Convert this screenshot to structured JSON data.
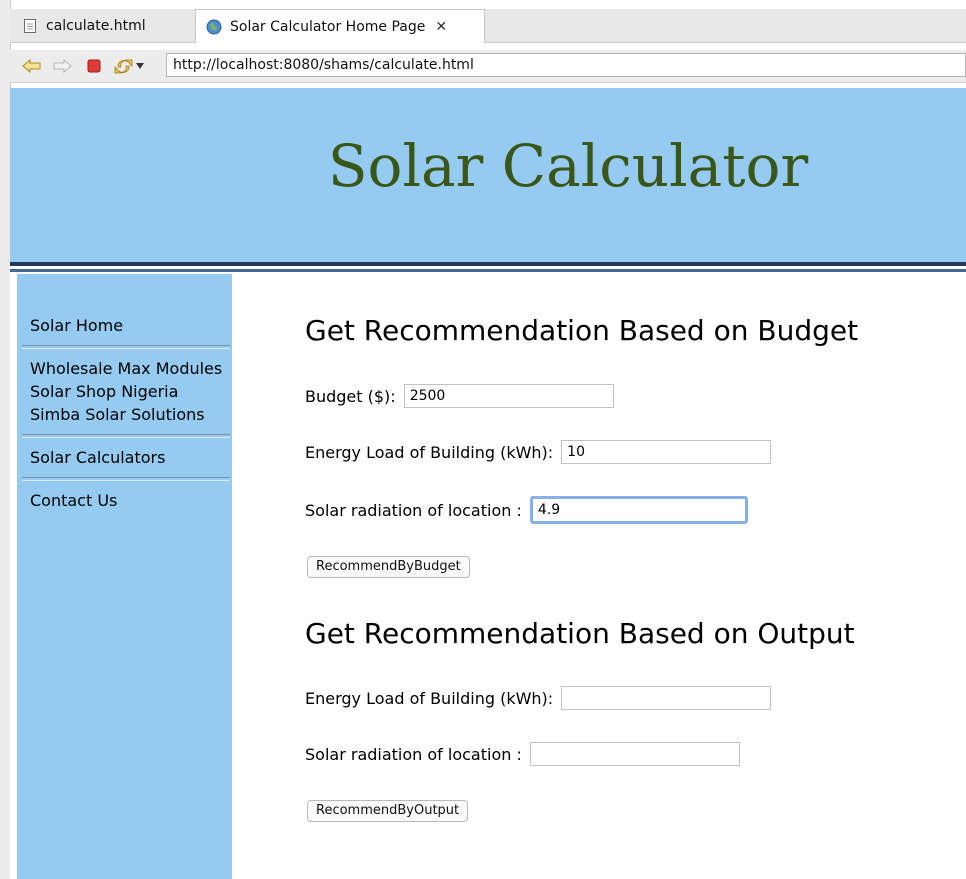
{
  "tabs": [
    {
      "label": "calculate.html",
      "active": false
    },
    {
      "label": "Solar Calculator Home Page",
      "active": true
    }
  ],
  "toolbar": {
    "url": "http://localhost:8080/shams/calculate.html"
  },
  "header": {
    "site_title": "Solar Calculator"
  },
  "sidebar": {
    "groups": [
      [
        "Solar Home"
      ],
      [
        "Wholesale Max Modules",
        "Solar Shop Nigeria",
        "Simba Solar Solutions"
      ],
      [
        "Solar Calculators"
      ],
      [
        "Contact Us"
      ]
    ]
  },
  "budget_section": {
    "title": "Get Recommendation Based on Budget",
    "budget_label": "Budget ($):",
    "budget_value": "2500",
    "load_label": "Energy Load of Building (kWh):",
    "load_value": "10",
    "radiation_label": "Solar radiation of location :",
    "radiation_value": "4.9",
    "button_label": "RecommendByBudget"
  },
  "output_section": {
    "title": "Get Recommendation Based on Output",
    "load_label": "Energy Load of Building (kWh):",
    "load_value": "",
    "radiation_label": "Solar radiation of location :",
    "radiation_value": "",
    "button_label": "RecommendByOutput"
  },
  "colors": {
    "header_bg": "#95cbf1",
    "title_color": "#3a5618",
    "rule_dark": "#213a59",
    "focus_ring": "#86b1e8"
  }
}
